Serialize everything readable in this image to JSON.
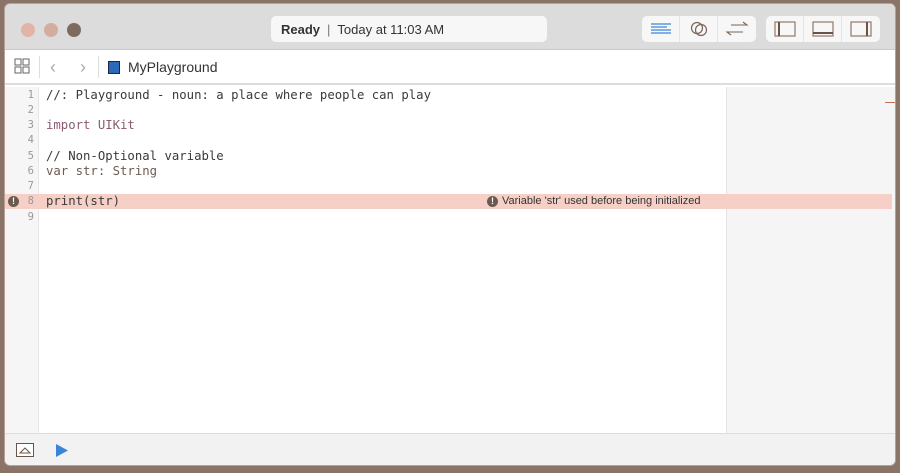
{
  "window": {
    "traffic_lights": [
      "#e3b3a6",
      "#d3ad9f",
      "#7d6b5e"
    ]
  },
  "status": {
    "state": "Ready",
    "time": "Today at 11:03 AM"
  },
  "toolbar": {
    "editor_buttons": [
      "standard-editor-icon",
      "assistant-editor-icon",
      "version-editor-icon"
    ],
    "panel_buttons": [
      "left-panel-icon",
      "bottom-panel-icon",
      "right-panel-icon"
    ]
  },
  "nav": {
    "file_name": "MyPlayground"
  },
  "code": {
    "lines": [
      {
        "n": "1",
        "text": "//: Playground - noun: a place where people can play"
      },
      {
        "n": "2",
        "text": ""
      },
      {
        "n": "3",
        "text": "import UIKit"
      },
      {
        "n": "4",
        "text": ""
      },
      {
        "n": "5",
        "text": "// Non-Optional variable"
      },
      {
        "n": "6",
        "text": "var str: String"
      },
      {
        "n": "7",
        "text": ""
      },
      {
        "n": "8",
        "text": "print(str)"
      },
      {
        "n": "9",
        "text": ""
      }
    ],
    "error_line": "8",
    "error_message": "Variable 'str' used before being initialized"
  },
  "colors": {
    "accent": "#3a85d8",
    "error_bg": "#f6d0c6"
  }
}
